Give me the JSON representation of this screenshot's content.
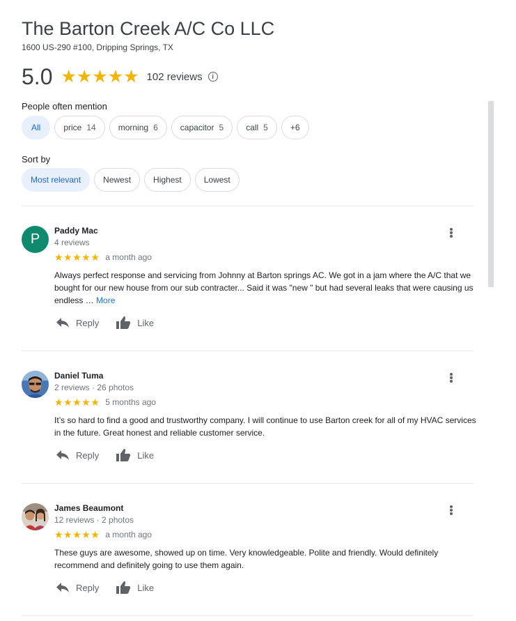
{
  "business": {
    "name": "The Barton Creek A/C Co LLC",
    "address": "1600 US-290 #100, Dripping Springs, TX",
    "rating": "5.0",
    "stars": "★★★★★",
    "review_count": "102 reviews",
    "info_glyph": "i"
  },
  "mentions": {
    "label": "People often mention",
    "chips": [
      {
        "label": "All",
        "count": ""
      },
      {
        "label": "price",
        "count": "14"
      },
      {
        "label": "morning",
        "count": "6"
      },
      {
        "label": "capacitor",
        "count": "5"
      },
      {
        "label": "call",
        "count": "5"
      },
      {
        "label": "+6",
        "count": ""
      }
    ]
  },
  "sort": {
    "label": "Sort by",
    "options": [
      "Most relevant",
      "Newest",
      "Highest",
      "Lowest"
    ],
    "selected": "Most relevant"
  },
  "reviews": [
    {
      "avatar_letter": "P",
      "name": "Paddy Mac",
      "meta": "4 reviews",
      "stars": "★★★★★",
      "rating": 5,
      "time": "a month ago",
      "text": "Always perfect  response and servicing from Johnny at Barton springs AC. We got in a jam where the A/C that we bought for our new house  from our sub contracter... Said it was \"new \" but had several leaks that were causing us endless … ",
      "more": "More",
      "reply": "Reply",
      "like": "Like"
    },
    {
      "avatar_letter": "",
      "name": "Daniel Tuma",
      "meta": "2 reviews · 26 photos",
      "stars": "★★★★★",
      "rating": 5,
      "time": "5 months ago",
      "text": "It’s so hard to find a good and trustworthy company. I will continue to use Barton creek for all of my HVAC services in the future. Great honest and reliable customer service.",
      "more": "",
      "reply": "Reply",
      "like": "Like"
    },
    {
      "avatar_letter": "",
      "name": "James Beaumont",
      "meta": "12 reviews · 2 photos",
      "stars": "★★★★★",
      "rating": 5,
      "time": "a month ago",
      "text": "These guys are awesome, showed up on time. Very knowledgeable. Polite and friendly. Would definitely recommend and definitely going to use them again.",
      "more": "",
      "reply": "Reply",
      "like": "Like"
    }
  ],
  "colors": {
    "star": "#f4b400",
    "accent": "#1a73e8",
    "active_chip_bg": "#e8f0fe"
  }
}
